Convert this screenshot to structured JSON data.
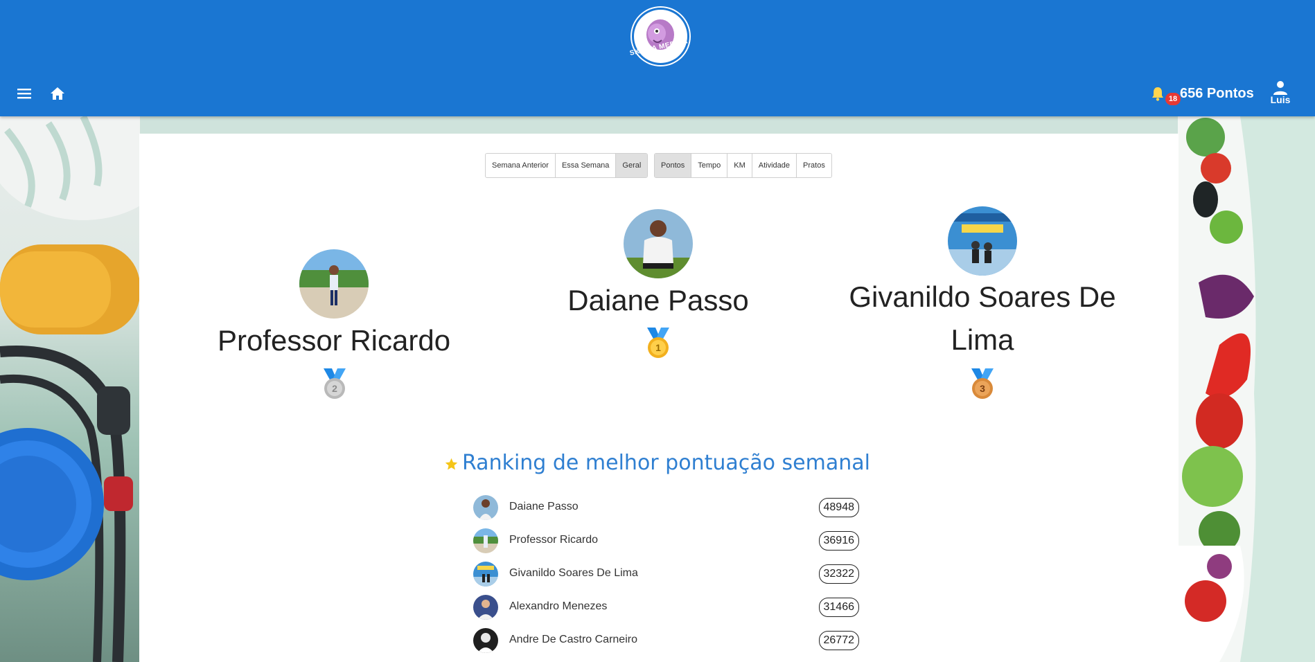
{
  "header": {
    "logo_text": "SKF NA MEDIDA",
    "notification_count": "18",
    "points": "656 Pontos",
    "user_name": "Luis",
    "color": "#1a76d2"
  },
  "filters": {
    "period": [
      {
        "label": "Semana Anterior",
        "active": false
      },
      {
        "label": "Essa Semana",
        "active": false
      },
      {
        "label": "Geral",
        "active": true
      }
    ],
    "metric": [
      {
        "label": "Pontos",
        "active": true
      },
      {
        "label": "Tempo",
        "active": false
      },
      {
        "label": "KM",
        "active": false
      },
      {
        "label": "Atividade",
        "active": false
      },
      {
        "label": "Pratos",
        "active": false
      }
    ]
  },
  "podium": {
    "first": {
      "name": "Daiane Passo",
      "medal": "1"
    },
    "second": {
      "name": "Professor Ricardo",
      "medal": "2"
    },
    "third": {
      "name_line1": "Givanildo Soares De",
      "name_line2": "Lima",
      "medal": "3"
    }
  },
  "ranking": {
    "title": "Ranking de melhor pontuação semanal",
    "rows": [
      {
        "name": "Daiane Passo",
        "score": "48948"
      },
      {
        "name": "Professor Ricardo",
        "score": "36916"
      },
      {
        "name": "Givanildo Soares De Lima",
        "score": "32322"
      },
      {
        "name": "Alexandro Menezes",
        "score": "31466"
      },
      {
        "name": "Andre De Castro Carneiro",
        "score": "26772"
      }
    ]
  },
  "medal_colors": {
    "gold": "#f2b01e",
    "silver": "#b9b9b9",
    "bronze": "#d98a3a",
    "ribbon": "#1e88e5"
  }
}
